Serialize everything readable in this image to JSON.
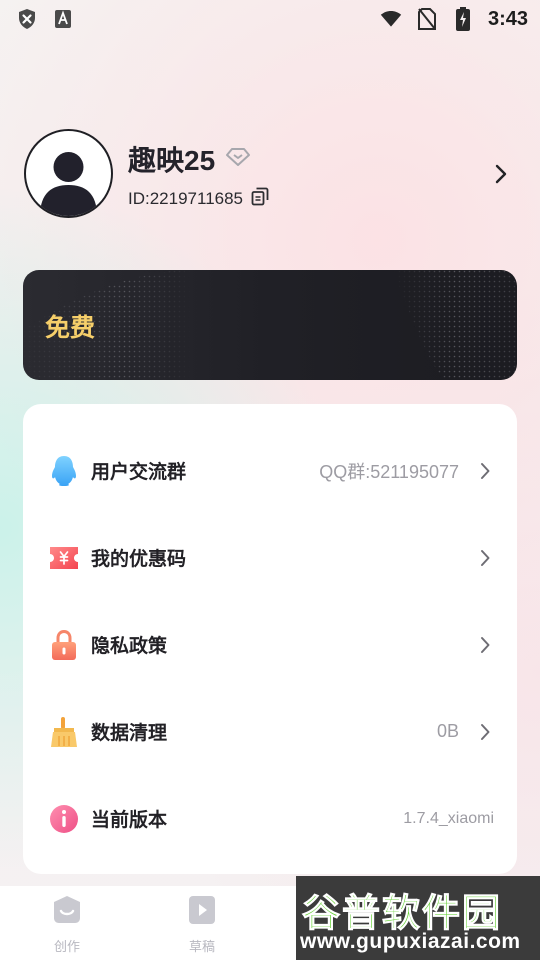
{
  "status_bar": {
    "time": "3:43",
    "left_icons": [
      "shield-x-icon",
      "font-a-icon"
    ],
    "right_icons": [
      "wifi-icon",
      "no-sim-icon",
      "battery-charging-icon"
    ]
  },
  "profile": {
    "username": "趣映25",
    "user_id": "ID:2219711685",
    "badge_icon": "diamond-badge-icon",
    "copy_icon": "copy-icon"
  },
  "vip_card": {
    "label": "免费",
    "label_color": "#f6cf6a"
  },
  "settings": {
    "items": [
      {
        "label": "用户交流群",
        "value": "QQ群:521195077",
        "icon": "qq-penguin-icon",
        "has_chevron": true
      },
      {
        "label": "我的优惠码",
        "value": "",
        "icon": "coupon-icon",
        "has_chevron": true
      },
      {
        "label": "隐私政策",
        "value": "",
        "icon": "lock-icon",
        "has_chevron": true
      },
      {
        "label": "数据清理",
        "value": "0B",
        "icon": "broom-icon",
        "has_chevron": true
      },
      {
        "label": "当前版本",
        "value": "1.7.4_xiaomi",
        "icon": "info-icon",
        "has_chevron": false
      }
    ]
  },
  "bottom_nav": {
    "items": [
      {
        "label": "创作",
        "icon": "create-icon"
      },
      {
        "label": "草稿",
        "icon": "draft-icon"
      }
    ]
  },
  "watermark": {
    "title": "谷普软件园",
    "url": "www.gupuxiazai.com"
  }
}
